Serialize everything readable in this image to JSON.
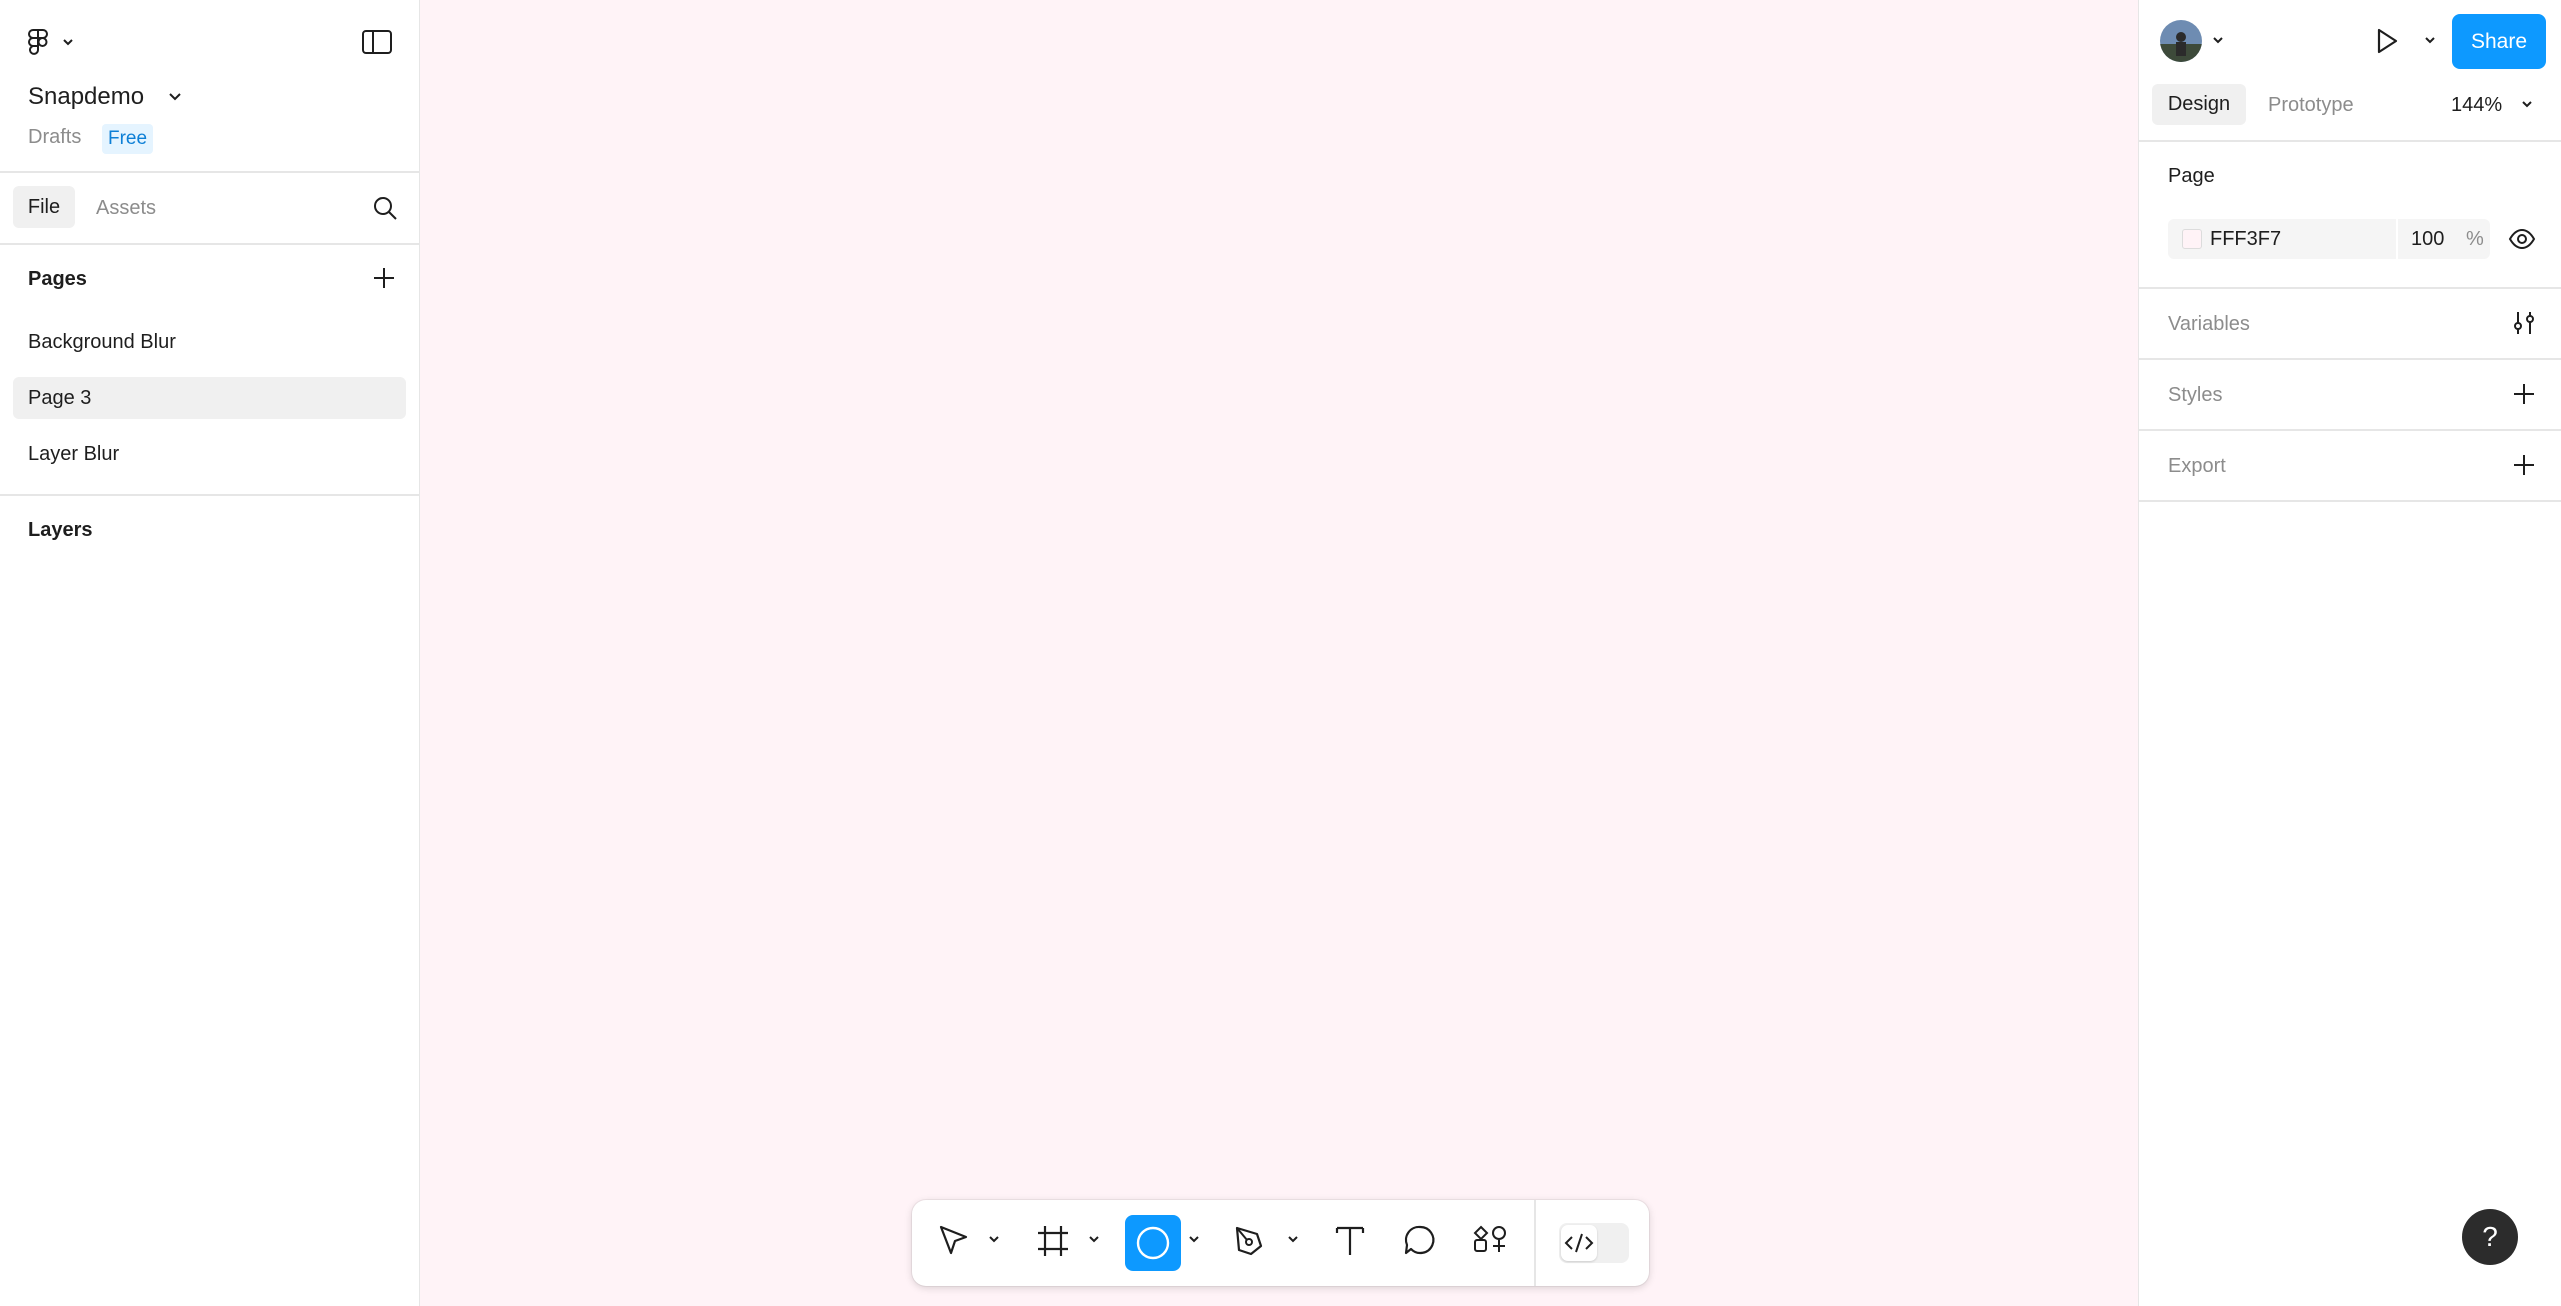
{
  "left_panel": {
    "file_name": "Snapdemo",
    "location": "Drafts",
    "plan_badge": "Free",
    "tabs": [
      {
        "label": "File"
      },
      {
        "label": "Assets"
      }
    ],
    "pages_heading": "Pages",
    "pages": [
      {
        "label": "Background Blur",
        "selected": false
      },
      {
        "label": "Page 3",
        "selected": true
      },
      {
        "label": "Layer Blur",
        "selected": false
      }
    ],
    "layers_heading": "Layers"
  },
  "canvas": {
    "background": "#FFF3F7"
  },
  "right_panel": {
    "share_label": "Share",
    "tabs": [
      {
        "label": "Design"
      },
      {
        "label": "Prototype"
      }
    ],
    "zoom": "144%",
    "page_section": "Page",
    "page_fill": {
      "hex": "FFF3F7",
      "opacity": "100",
      "unit": "%"
    },
    "sections": [
      {
        "label": "Variables"
      },
      {
        "label": "Styles"
      },
      {
        "label": "Export"
      }
    ]
  },
  "toolbar": {
    "tools": [
      "move-tool",
      "frame-tool",
      "ellipse-tool",
      "pen-tool",
      "text-tool",
      "comment-tool",
      "actions-tool"
    ],
    "active_tool": "ellipse-tool",
    "dev_mode": false
  },
  "help": {
    "label": "?"
  },
  "colors": {
    "accent": "#0d99ff",
    "canvas": "#fff3f7",
    "help": "#2c2c2c"
  }
}
